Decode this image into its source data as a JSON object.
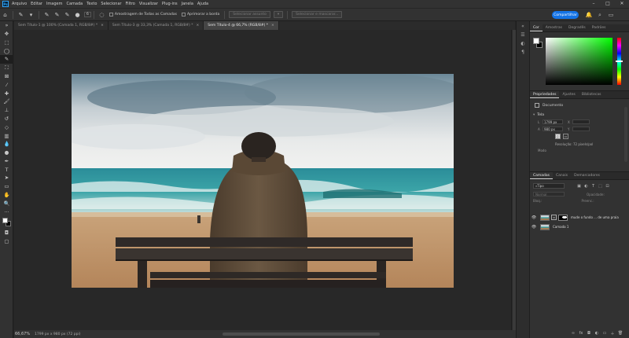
{
  "menubar": {
    "logo": "Ps",
    "items": [
      "Arquivo",
      "Editar",
      "Imagem",
      "Camada",
      "Texto",
      "Selecionar",
      "Filtro",
      "Visualizar",
      "Plug-ins",
      "Janela",
      "Ajuda"
    ],
    "window_controls": [
      "–",
      "□",
      "✕"
    ]
  },
  "options": {
    "brush_size": "6",
    "sample_all_layers": "Amostragem de Todas as Camadas",
    "enhance_edge": "Aprimorar a borda",
    "select_subject": "Selecionar assunto",
    "select_and_mask": "Selecionar e mascarar...",
    "share": "Compartilhar"
  },
  "tabs": [
    {
      "label": "Sem Título-1 @ 100% (Camada 1, RGB/8#) *",
      "close": "×"
    },
    {
      "label": "Sem Título-3 @ 33,3% (Camada 1, RGB/8#) *",
      "close": "×"
    },
    {
      "label": "Sem Título-4 @ 66,7% (RGB/8#) *",
      "close": "×"
    }
  ],
  "status": {
    "zoom": "66,67%",
    "doc_info": "1799 px x 980 px (72 ppi)"
  },
  "color_panel": {
    "tabs": [
      "Cor",
      "Amostras",
      "Degradês",
      "Padrões"
    ],
    "foreground": "#ffffff",
    "background": "#000000"
  },
  "properties": {
    "tabs": [
      "Propriedades",
      "Ajustes",
      "Bibliotecas"
    ],
    "doc_label": "Documento",
    "section": "Tela",
    "width_label": "L",
    "width_value": "1799 px",
    "x_label": "X",
    "height_label": "A",
    "height_value": "980 px",
    "y_label": "Y",
    "resolution": "Resolução: 72 pixels/pol",
    "mode": "Modo"
  },
  "layers": {
    "tabs": [
      "Camadas",
      "Canais",
      "Demarcadores"
    ],
    "kind": "Tipo",
    "blend_mode": "Normal",
    "opacity_label": "Opacidade:",
    "lock_label": "Bloq.:",
    "fill_label": "Preenc.:",
    "items": [
      {
        "name": "mude o fundo ... de uma praia",
        "visible": "👁"
      },
      {
        "name": "Camada 1",
        "visible": "👁"
      }
    ]
  },
  "colors": {
    "accent": "#1473e6",
    "app_bg": "#252525",
    "panel_bg": "#323232"
  }
}
